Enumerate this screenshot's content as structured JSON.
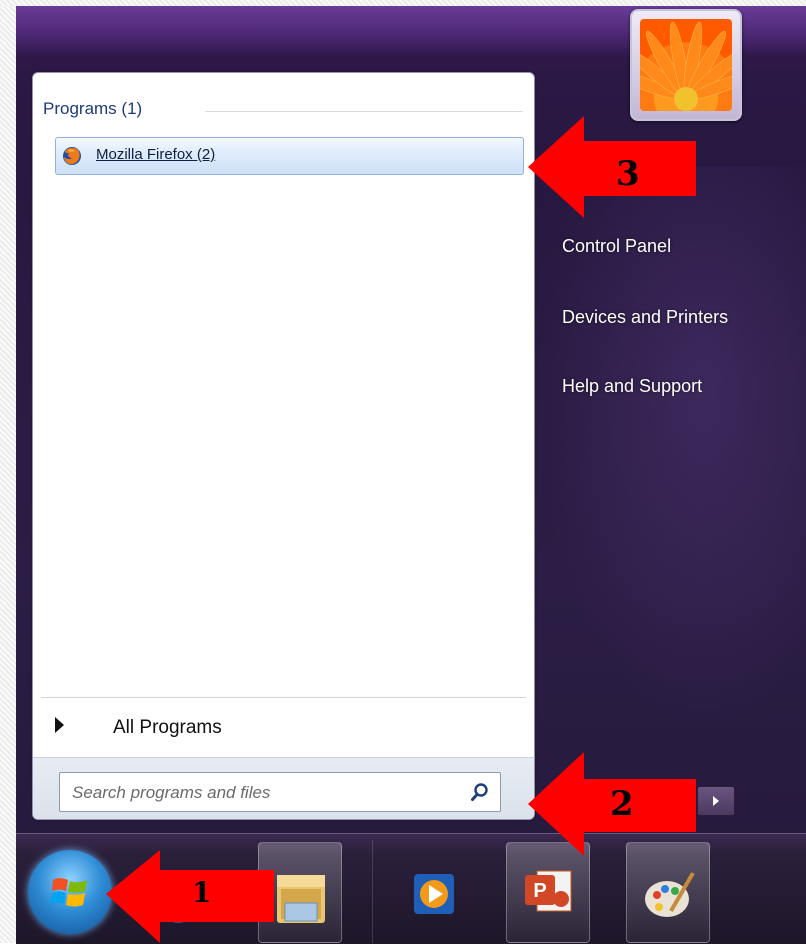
{
  "start_menu": {
    "search_results": {
      "header": "Programs (1)",
      "items": [
        {
          "label": "Mozilla Firefox (2)",
          "icon": "firefox-icon"
        }
      ]
    },
    "all_programs_label": "All Programs",
    "search": {
      "placeholder": "Search programs and files",
      "icon": "search-icon"
    },
    "right_pane": {
      "links": [
        {
          "label": "Control Panel"
        },
        {
          "label": "Devices and Printers"
        },
        {
          "label": "Help and Support"
        }
      ]
    }
  },
  "taskbar": {
    "start_button": "windows-start-icon",
    "pinned": [
      {
        "icon": "internet-explorer-icon"
      },
      {
        "icon": "windows-explorer-icon"
      },
      {
        "icon": "media-player-icon"
      },
      {
        "icon": "powerpoint-icon"
      },
      {
        "icon": "paint-icon"
      }
    ]
  },
  "annotations": [
    {
      "number": "1"
    },
    {
      "number": "2"
    },
    {
      "number": "3"
    }
  ],
  "colors": {
    "annotation_red": "#ff0000",
    "menu_background": "#2a1b43",
    "selection_blue": "#dceafb"
  }
}
